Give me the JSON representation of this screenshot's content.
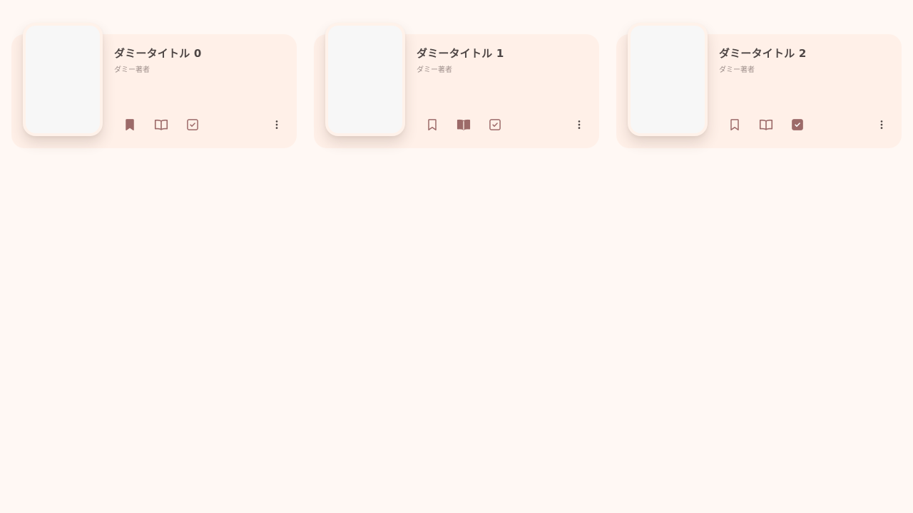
{
  "colors": {
    "page_background": "#fff8f4",
    "card_background": "#fff0e8",
    "cover_background": "#f7f7f7",
    "accent": "#9c6a69",
    "title": "#4d4544",
    "author": "#9e8f8b"
  },
  "icons": {
    "bookmark": "bookmark-icon",
    "reading": "open-book-icon",
    "done": "checkbox-icon",
    "more": "more-vert-icon"
  },
  "books": [
    {
      "title": "ダミータイトル 0",
      "author": "ダミー著者",
      "status": "bookmark"
    },
    {
      "title": "ダミータイトル 1",
      "author": "ダミー著者",
      "status": "reading"
    },
    {
      "title": "ダミータイトル 2",
      "author": "ダミー著者",
      "status": "done"
    }
  ]
}
